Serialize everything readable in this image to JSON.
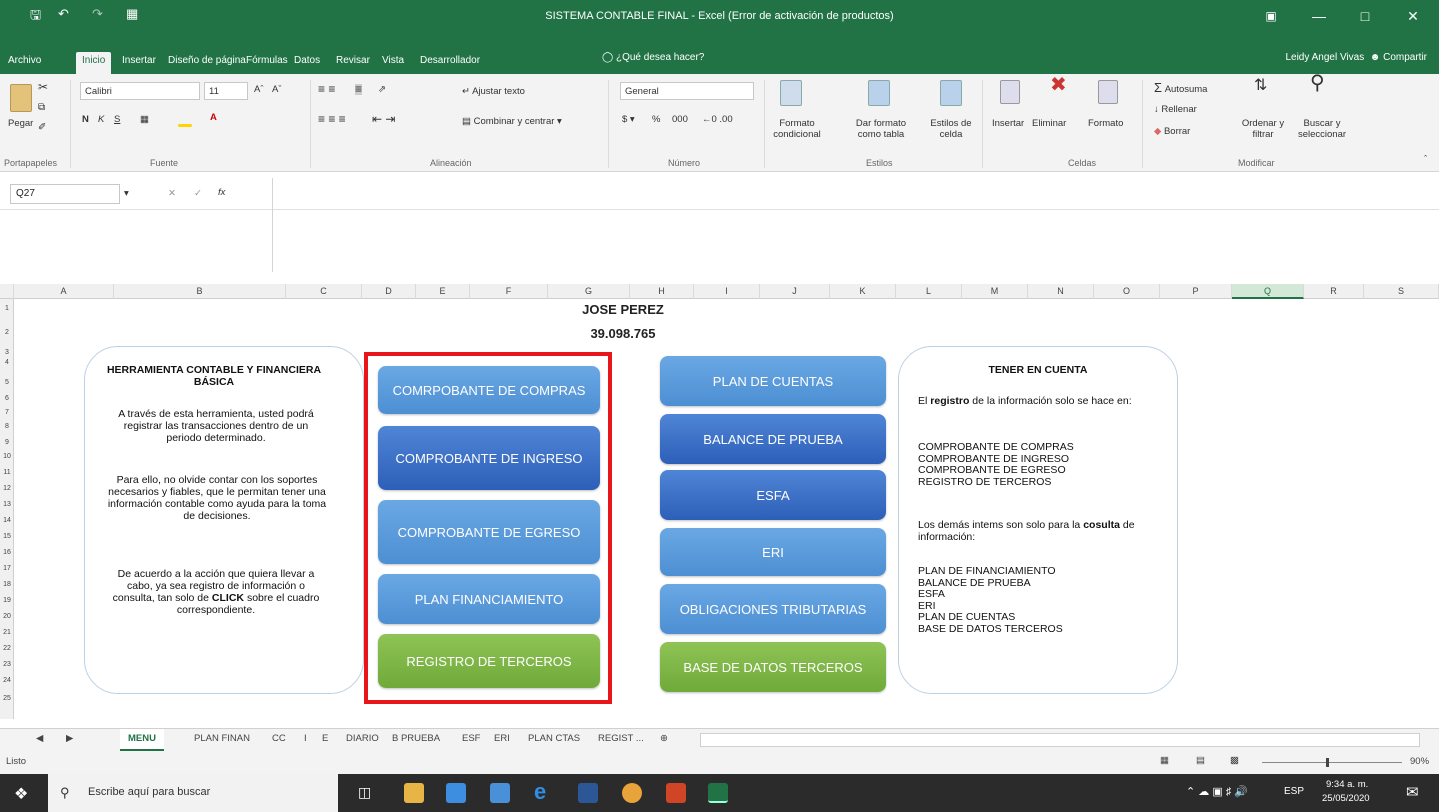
{
  "window": {
    "title": "SISTEMA CONTABLE FINAL - Excel (Error de activación de productos)",
    "user": "Leidy Angel Vivas",
    "share": "Compartir"
  },
  "ribbon_tabs": [
    "Archivo",
    "Inicio",
    "Insertar",
    "Diseño de página",
    "Fórmulas",
    "Datos",
    "Revisar",
    "Vista",
    "Desarrollador"
  ],
  "tell_me": "¿Qué desea hacer?",
  "ribbon": {
    "paste": "Pegar",
    "font_name": "Calibri",
    "font_size": "11",
    "wrap_text": "Ajustar texto",
    "merge_center": "Combinar y centrar",
    "number_format": "General",
    "cond_format": "Formato condicional",
    "format_table": "Dar formato como tabla",
    "cell_styles": "Estilos de celda",
    "insert": "Insertar",
    "delete": "Eliminar",
    "format": "Formato",
    "autosum": "Autosuma",
    "fill": "Rellenar",
    "clear": "Borrar",
    "sort_filter": "Ordenar y filtrar",
    "find_select": "Buscar y seleccionar",
    "groups": [
      "Portapapeles",
      "Fuente",
      "Alineación",
      "Número",
      "Estilos",
      "Celdas",
      "Modificar"
    ]
  },
  "name_box": "Q27",
  "fx": "fx",
  "columns": [
    "A",
    "B",
    "C",
    "D",
    "E",
    "F",
    "G",
    "H",
    "I",
    "J",
    "K",
    "L",
    "M",
    "N",
    "O",
    "P",
    "Q",
    "R",
    "S"
  ],
  "rows": [
    "1",
    "2",
    "3",
    "4",
    "5",
    "6",
    "7",
    "8",
    "9",
    "10",
    "11",
    "12",
    "13",
    "14",
    "15",
    "16",
    "17",
    "18",
    "19",
    "20",
    "21",
    "22",
    "23",
    "24",
    "25"
  ],
  "sheet": {
    "name_title": "JOSE PEREZ",
    "id_number": "39.098.765",
    "left_card": {
      "heading": "HERRAMIENTA CONTABLE Y FINANCIERA BÁSICA",
      "p1": "A través de esta herramienta, usted podrá registrar las transacciones dentro de un periodo determinado.",
      "p2": "Para ello, no olvide contar con los soportes necesarios y fiables, que le permitan tener una información contable como ayuda para la toma de decisiones.",
      "p3a": "De acuerdo a la acción que quiera llevar a cabo, ya sea registro de información o consulta, tan solo de",
      "p3_bold": "CLICK",
      "p3b": "sobre el cuadro correspondiente."
    },
    "buttons_left": [
      "COMRPOBANTE DE COMPRAS",
      "COMPROBANTE DE INGRESO",
      "COMPROBANTE DE EGRESO",
      "PLAN FINANCIAMIENTO",
      "REGISTRO DE TERCEROS"
    ],
    "buttons_right": [
      "PLAN DE CUENTAS",
      "BALANCE DE PRUEBA",
      "ESFA",
      "ERI",
      "OBLIGACIONES TRIBUTARIAS",
      "BASE DE DATOS TERCEROS"
    ],
    "right_card": {
      "heading": "TENER EN CUENTA",
      "intro_pre": "El",
      "intro_bold": "registro",
      "intro_post": "de la información solo se hace en:",
      "list1": [
        "COMPROBANTE DE COMPRAS",
        "COMPROBANTE DE INGRESO",
        "COMPROBANTE DE EGRESO",
        "REGISTRO DE TERCEROS"
      ],
      "mid_pre": "Los demás intems son solo para la",
      "mid_bold": "cosulta",
      "mid_post": "de información:",
      "list2": [
        "PLAN DE FINANCIAMIENTO",
        "BALANCE DE PRUEBA",
        "ESFA",
        "ERI",
        "PLAN DE CUENTAS",
        "BASE DE DATOS TERCEROS"
      ]
    }
  },
  "sheet_tabs": [
    "MENU",
    "PLAN FINAN",
    "CC",
    "I",
    "E",
    "DIARIO",
    "B PRUEBA",
    "ESF",
    "ERI",
    "PLAN CTAS",
    "REGIST ..."
  ],
  "status": {
    "mode": "Listo",
    "zoom": "90%"
  },
  "taskbar": {
    "search_placeholder": "Escribe aquí para buscar",
    "time": "9:34 a. m.",
    "date": "25/05/2020",
    "lang": "ESP"
  },
  "colors": {
    "excel_green": "#217346",
    "highlight_red": "#e8161a",
    "button_blue": "#4d8fd3",
    "button_dark": "#2d5fb8",
    "button_green": "#6faa3a"
  }
}
